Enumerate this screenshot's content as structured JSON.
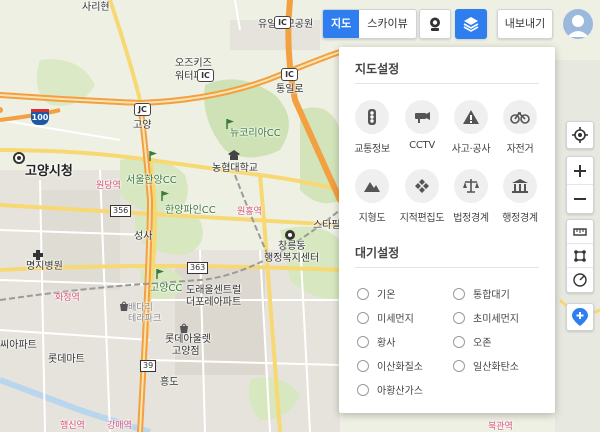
{
  "top_bar": {
    "map_type_map": "지도",
    "map_type_skyview": "스카이뷰",
    "export_label": "내보내기"
  },
  "map": {
    "places": {
      "sariri": "사리현",
      "yuil": "유일우모공원",
      "ozkids": "오즈키즈",
      "waterpark": "워터파크",
      "tongillo": "통일로",
      "goyangsicheong": "고양시청",
      "goyang_jc_label": "고양",
      "newkoreacc": "뉴코리아CC",
      "nonghyup_univ": "농협대학교",
      "seoul_hanyang_cc": "서울한양CC",
      "goyangdong_pink": "원당역",
      "hanyang_pine_cc": "한양파인CC",
      "wondang_pink": "원흥역",
      "star": "스타필",
      "seongsa": "성사",
      "changneung": "창릉동",
      "changneung2": "행정복지센터",
      "myeongji_hosp": "명지병원",
      "goyang_cc": "고양CC",
      "dorae": "도래울센트럴",
      "dorae2": "더포레아파트",
      "hwajeong": "화정역",
      "baedari": "배다리",
      "terapark": "테라파크",
      "pink_hwajeong": "화정역",
      "ssiapt": "씨아파트",
      "lotte_apt": "롯데아울렛",
      "lotte_apt2": "고양점",
      "lotte_mart": "롯데마트",
      "heungdo": "흥도",
      "haengsin": "행신역",
      "gimi": "강매역",
      "bukgyo": "북관역"
    },
    "road_badges": {
      "ic1": "IC",
      "ic2": "IC",
      "ic3": "IC",
      "jc1": "JC",
      "hwy100": "100",
      "r356": "356",
      "r363": "363",
      "r39": "39"
    }
  },
  "panel": {
    "map_settings_title": "지도설정",
    "layers": [
      {
        "label": "교통정보",
        "icon": "traffic-light-icon"
      },
      {
        "label": "CCTV",
        "icon": "cctv-icon"
      },
      {
        "label": "사고·공사",
        "icon": "warning-icon"
      },
      {
        "label": "자전거",
        "icon": "bicycle-icon"
      },
      {
        "label": "지형도",
        "icon": "terrain-icon"
      },
      {
        "label": "지적편집도",
        "icon": "cadastral-icon"
      },
      {
        "label": "법정경계",
        "icon": "legal-boundary-icon"
      },
      {
        "label": "행정경계",
        "icon": "administrative-boundary-icon"
      }
    ],
    "air_title": "대기설정",
    "air_options": [
      {
        "label": "기온"
      },
      {
        "label": "통합대기"
      },
      {
        "label": "미세먼지"
      },
      {
        "label": "초미세먼지"
      },
      {
        "label": "황사"
      },
      {
        "label": "오존"
      },
      {
        "label": "이산화질소"
      },
      {
        "label": "일산화탄소"
      },
      {
        "label": "아황산가스"
      }
    ]
  },
  "colors": {
    "accent": "#2f7ef0",
    "highway": "#f5a34a",
    "road_yellow": "#f7d873",
    "park_green": "#cfe2b5",
    "urban": "#e3e1da"
  }
}
